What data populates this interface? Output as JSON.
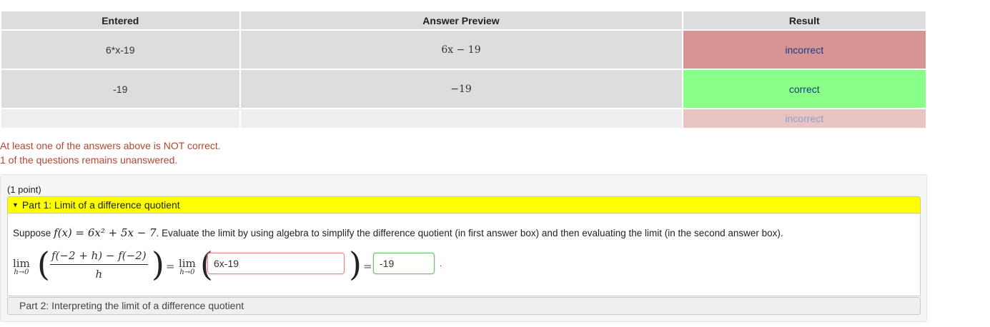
{
  "table": {
    "headers": [
      "Entered",
      "Answer Preview",
      "Result"
    ],
    "rows": [
      {
        "entered": "6*x-19",
        "preview": "6x − 19",
        "result": "incorrect"
      },
      {
        "entered": "-19",
        "preview": "−19",
        "result": "correct"
      },
      {
        "entered": "",
        "preview": "",
        "result": "incorrect"
      }
    ]
  },
  "messages": {
    "not_correct": "At least one of the answers above is NOT correct.",
    "unanswered": "1 of the questions remains unanswered."
  },
  "problem": {
    "points": "(1 point)",
    "part1": {
      "title": "Part 1: Limit of a difference quotient",
      "statement_prefix": "Suppose",
      "function": "f(x) = 6x² + 5x − 7",
      "statement_suffix": ". Evaluate the limit by using algebra to simplify the difference quotient (in first answer box) and then evaluating the limit (in the second answer box).",
      "lim_label": "lim",
      "lim_sub": "h→0",
      "numerator": "f(−2 + h) − f(−2)",
      "denominator": "h",
      "equals": "=",
      "answer1": "6x-19",
      "answer2": "-19",
      "trailing": "."
    },
    "part2": {
      "title": "Part 2: Interpreting the limit of a difference quotient"
    }
  },
  "colors": {
    "incorrect_bg": "#d69594",
    "correct_bg": "#8aff88",
    "part_header_bg": "#ffff00",
    "message_color": "#b4472f"
  }
}
